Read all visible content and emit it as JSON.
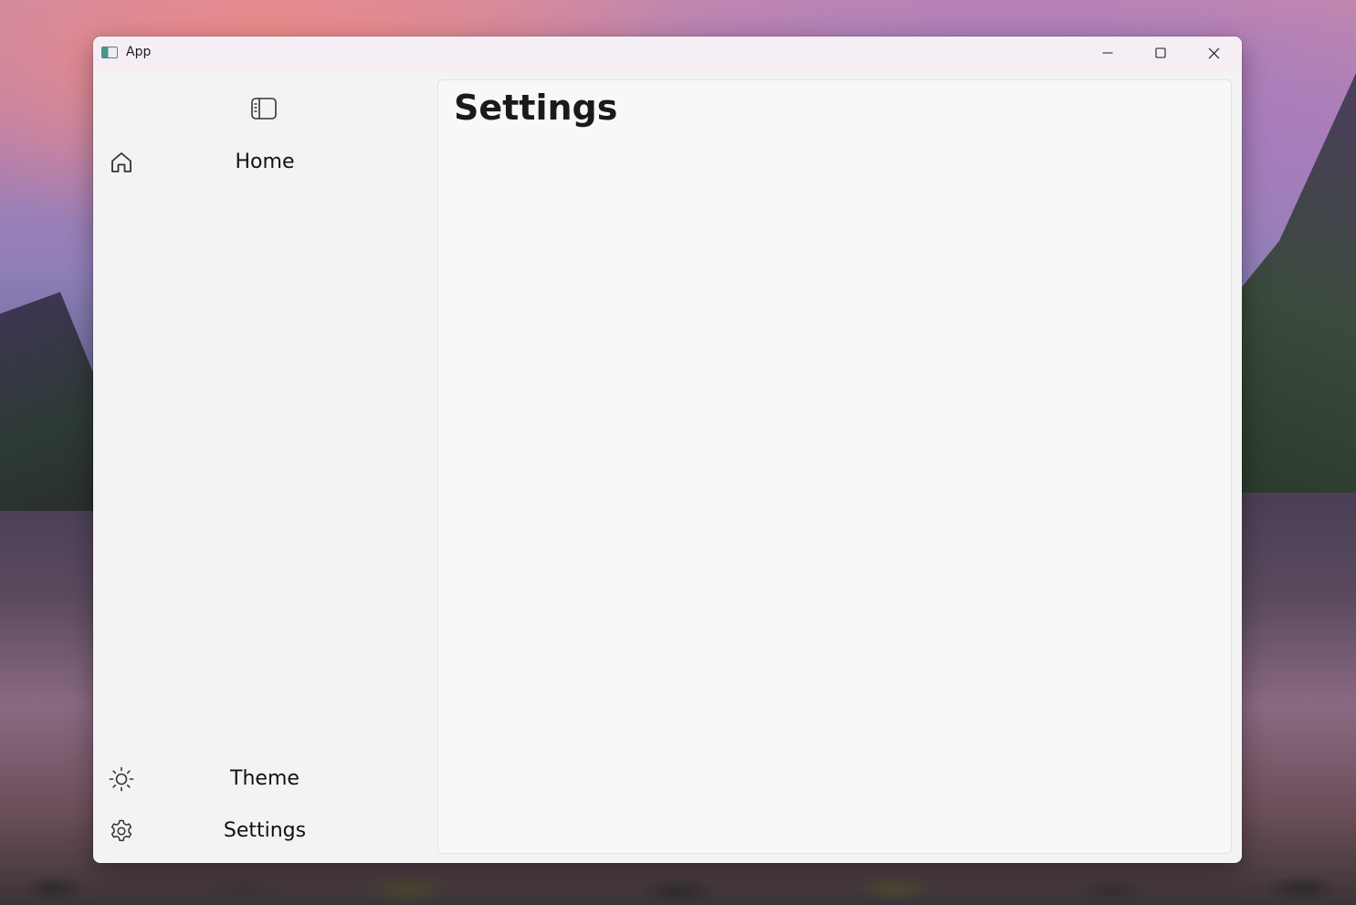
{
  "window": {
    "title": "App",
    "icon": "app-window-icon",
    "controls": {
      "minimize": "minimize-icon",
      "maximize": "maximize-icon",
      "close": "close-icon"
    }
  },
  "sidebar": {
    "toggle_icon": "sidebar-toggle-icon",
    "items": [
      {
        "label": "Home",
        "icon": "home-icon"
      }
    ],
    "footer_items": [
      {
        "label": "Theme",
        "icon": "sun-icon"
      },
      {
        "label": "Settings",
        "icon": "gear-icon"
      }
    ]
  },
  "main": {
    "title": "Settings"
  },
  "colors": {
    "titlebar": "#f6eef5",
    "sidebar": "#f3f3f3",
    "content": "#f7f8f9",
    "text": "#1a1a1a"
  }
}
